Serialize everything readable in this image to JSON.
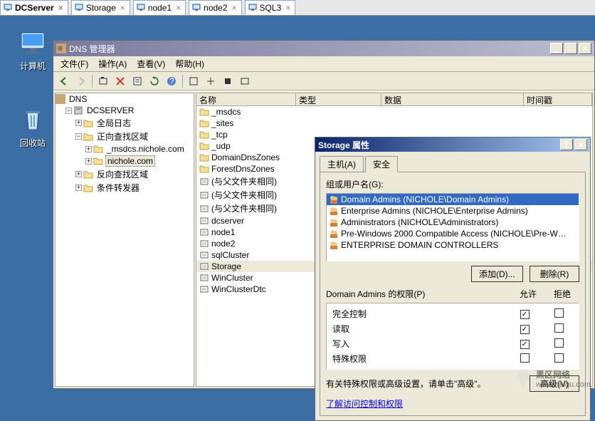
{
  "vm_tabs": [
    {
      "label": "DCServer",
      "active": true
    },
    {
      "label": "Storage",
      "active": false
    },
    {
      "label": "node1",
      "active": false
    },
    {
      "label": "node2",
      "active": false
    },
    {
      "label": "SQL3",
      "active": false
    }
  ],
  "desktop": {
    "computer_label": "计算机",
    "recycle_label": "回收站"
  },
  "mmc": {
    "title": "DNS 管理器",
    "menus": [
      "文件(F)",
      "操作(A)",
      "查看(V)",
      "帮助(H)"
    ],
    "tree": {
      "root": "DNS",
      "server": "DCSERVER",
      "global_log": "全局日志",
      "fwd_zones": "正向查找区域",
      "zone_msdcs": "_msdcs.nichole.com",
      "zone_nichole": "nichole.com",
      "rev_zones": "反向查找区域",
      "cond_fwd": "条件转发器"
    },
    "columns": [
      "名称",
      "类型",
      "数据",
      "时间戳"
    ],
    "rows": [
      {
        "kind": "folder",
        "label": "_msdcs"
      },
      {
        "kind": "folder",
        "label": "_sites"
      },
      {
        "kind": "folder",
        "label": "_tcp"
      },
      {
        "kind": "folder",
        "label": "_udp"
      },
      {
        "kind": "folder",
        "label": "DomainDnsZones"
      },
      {
        "kind": "folder",
        "label": "ForestDnsZones"
      },
      {
        "kind": "soa",
        "label": "(与父文件夹相同)"
      },
      {
        "kind": "soa",
        "label": "(与父文件夹相同)"
      },
      {
        "kind": "soa",
        "label": "(与父文件夹相同)"
      },
      {
        "kind": "host",
        "label": "dcserver"
      },
      {
        "kind": "host",
        "label": "node1"
      },
      {
        "kind": "host",
        "label": "node2"
      },
      {
        "kind": "host",
        "label": "sqlCluster"
      },
      {
        "kind": "host",
        "label": "Storage",
        "selected": true
      },
      {
        "kind": "host",
        "label": "WinCluster"
      },
      {
        "kind": "host",
        "label": "WinClusterDtc"
      }
    ]
  },
  "props": {
    "title": "Storage 属性",
    "tab_host": "主机(A)",
    "tab_security": "安全",
    "group_label": "组或用户名(G):",
    "groups": [
      {
        "name": "Domain Admins (NICHOLE\\Domain Admins)",
        "selected": true
      },
      {
        "name": "Enterprise Admins (NICHOLE\\Enterprise Admins)"
      },
      {
        "name": "Administrators (NICHOLE\\Administrators)"
      },
      {
        "name": "Pre-Windows 2000 Compatible Access (NICHOLE\\Pre-W…"
      },
      {
        "name": "ENTERPRISE DOMAIN CONTROLLERS"
      }
    ],
    "btn_add": "添加(D)...",
    "btn_remove": "删除(R)",
    "perm_label": "Domain Admins 的权限(P)",
    "col_allow": "允许",
    "col_deny": "拒绝",
    "perms": [
      {
        "name": "完全控制",
        "allow": true,
        "deny": false
      },
      {
        "name": "读取",
        "allow": true,
        "deny": false
      },
      {
        "name": "写入",
        "allow": true,
        "deny": false
      },
      {
        "name": "特殊权限",
        "allow": false,
        "deny": false
      }
    ],
    "adv_msg": "有关特殊权限或高级设置，请单击\"高级\"。",
    "btn_advanced": "高级(V)",
    "link": "了解访问控制和权限"
  },
  "watermark": {
    "text": "黑区网络",
    "url": "www.heiqu.com"
  }
}
